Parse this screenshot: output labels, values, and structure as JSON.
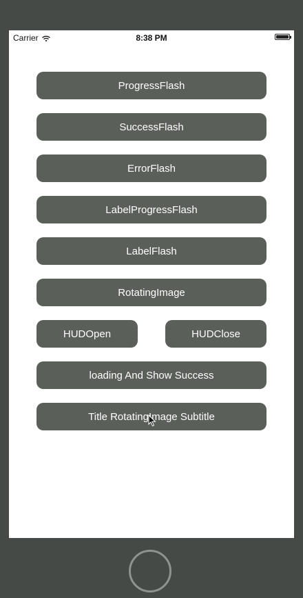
{
  "status_bar": {
    "carrier": "Carrier",
    "time": "8:38 PM"
  },
  "buttons": {
    "progress_flash": "ProgressFlash",
    "success_flash": "SuccessFlash",
    "error_flash": "ErrorFlash",
    "label_progress_flash": "LabelProgressFlash",
    "label_flash": "LabelFlash",
    "rotating_image": "RotatingImage",
    "hud_open": "HUDOpen",
    "hud_close": "HUDClose",
    "loading_show_success": "loading And Show Success",
    "title_rotating_image_subtitle": "Title RotatingImage Subtitle"
  },
  "icons": {
    "wifi": "wifi-icon",
    "battery": "battery-icon",
    "cursor": "mouse-cursor-icon",
    "home": "home-button"
  },
  "colors": {
    "button_bg": "#5b5f59",
    "button_text": "#ffffff",
    "device_frame": "#454a46",
    "screen_bg": "#ffffff"
  }
}
